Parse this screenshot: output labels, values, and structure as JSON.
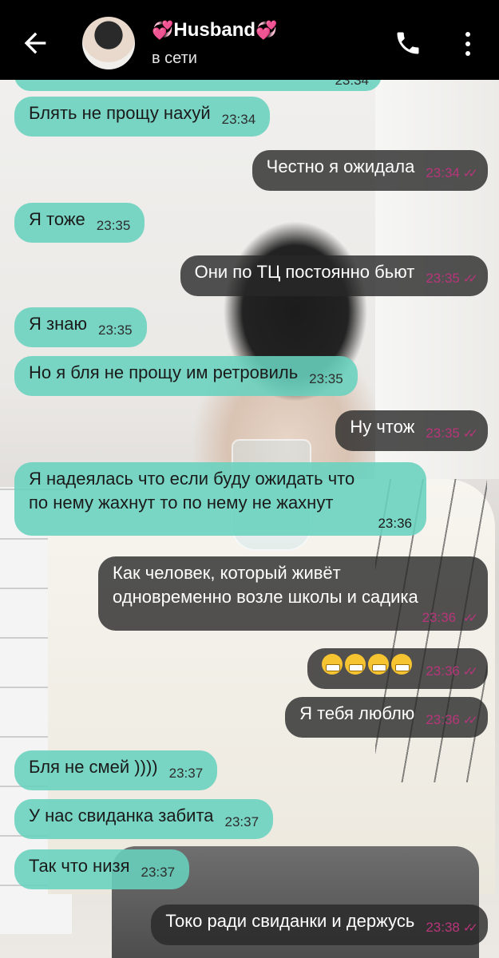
{
  "header": {
    "title": "Husband",
    "status": "в сети",
    "heart_left": "💞",
    "heart_right": "💞"
  },
  "messages": [
    {
      "dir": "in",
      "text": "",
      "time": "23:34"
    },
    {
      "dir": "in",
      "text": "Блять не прощу нахуй",
      "time": "23:34"
    },
    {
      "dir": "out",
      "text": "Честно я ожидала",
      "time": "23:34"
    },
    {
      "dir": "in",
      "text": "Я тоже",
      "time": "23:35"
    },
    {
      "dir": "out",
      "text": "Они по ТЦ постоянно бьют",
      "time": "23:35"
    },
    {
      "dir": "in",
      "text": "Я знаю",
      "time": "23:35"
    },
    {
      "dir": "in",
      "text": "Но я бля не прощу им ретровиль",
      "time": "23:35"
    },
    {
      "dir": "out",
      "text": "Ну чтож",
      "time": "23:35"
    },
    {
      "dir": "in",
      "line1": "Я надеялась что если буду ожидать что",
      "line2": "по нему жахнут то по нему не жахнут",
      "time": "23:36"
    },
    {
      "dir": "out",
      "line1": "Как человек, который живёт",
      "line2": "одновременно возле школы и садика",
      "time": "23:36"
    },
    {
      "dir": "out",
      "text": "",
      "time": "23:36"
    },
    {
      "dir": "out",
      "text": "Я тебя люблю",
      "time": "23:36"
    },
    {
      "dir": "in",
      "text": "Бля не смей ))))",
      "time": "23:37"
    },
    {
      "dir": "in",
      "text": "У нас свиданка забита",
      "time": "23:37"
    },
    {
      "dir": "in",
      "text": "Так что низя",
      "time": "23:37"
    },
    {
      "dir": "out",
      "text": "Токо ради свиданки и держусь",
      "time": "23:38"
    }
  ],
  "ticks": "✓✓",
  "colors": {
    "incoming_bubble": "#68d2be",
    "outgoing_bubble": "#282828",
    "outgoing_time": "#b8357a",
    "header_bg": "#000000"
  },
  "icons": {
    "back": "arrow-left-icon",
    "call": "phone-icon",
    "menu": "more-vertical-icon",
    "emoji": "grimacing-face-icon"
  }
}
